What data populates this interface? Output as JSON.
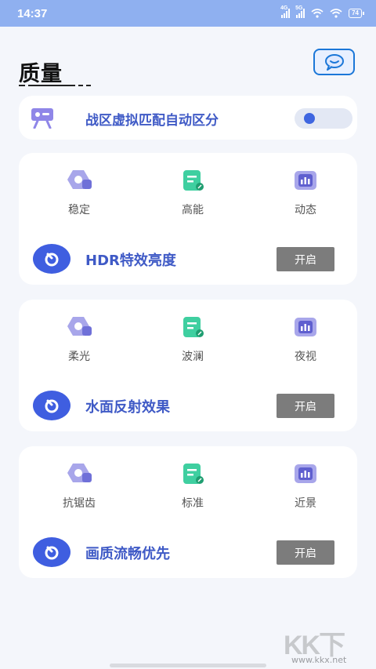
{
  "status_bar": {
    "time": "14:37",
    "net1": "4G",
    "net2": "5G",
    "battery": "74"
  },
  "page": {
    "title": "质量"
  },
  "toggle_row": {
    "label": "战区虚拟匹配自动区分",
    "enabled": true
  },
  "groups": [
    {
      "options": [
        {
          "label": "稳定",
          "icon": "hexagon-icon"
        },
        {
          "label": "高能",
          "icon": "document-icon"
        },
        {
          "label": "动态",
          "icon": "bar-chart-icon"
        }
      ],
      "feature": "HDR特效亮度",
      "button": "开启"
    },
    {
      "options": [
        {
          "label": "柔光",
          "icon": "hexagon-icon"
        },
        {
          "label": "波澜",
          "icon": "document-icon"
        },
        {
          "label": "夜视",
          "icon": "bar-chart-icon"
        }
      ],
      "feature": "水面反射效果",
      "button": "开启"
    },
    {
      "options": [
        {
          "label": "抗锯齿",
          "icon": "hexagon-icon"
        },
        {
          "label": "标准",
          "icon": "document-icon"
        },
        {
          "label": "近景",
          "icon": "bar-chart-icon"
        }
      ],
      "feature": "画质流畅优先",
      "button": "开启"
    }
  ],
  "watermark": {
    "logo": "KK下载",
    "url": "www.kkx.net"
  },
  "colors": {
    "accent": "#3f5ac6",
    "status_bar": "#8fb0f0",
    "button_gray": "#7c7c7c"
  }
}
